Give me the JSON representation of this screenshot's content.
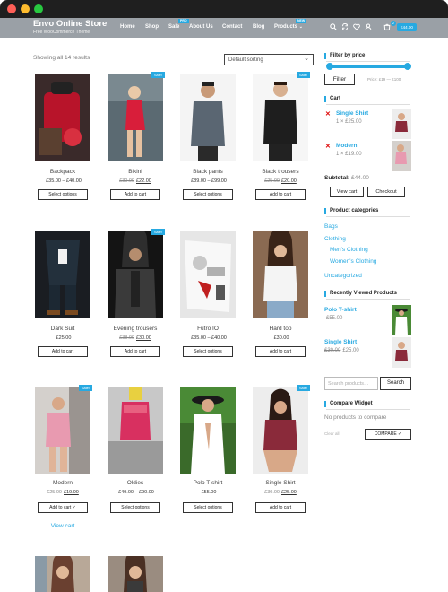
{
  "header": {
    "brand": "Envo Online Store",
    "tagline": "Free WooCommerce Theme",
    "nav": [
      {
        "label": "Home"
      },
      {
        "label": "Shop"
      },
      {
        "label": "Sale",
        "badge": "PRO"
      },
      {
        "label": "About Us"
      },
      {
        "label": "Contact"
      },
      {
        "label": "Blog"
      },
      {
        "label": "Products",
        "badge": "NEW",
        "icon": "chevron-down-icon"
      }
    ],
    "icons": [
      "search-icon",
      "compare-icon",
      "heart-icon",
      "user-icon",
      "cart-icon"
    ],
    "cart_count": "2",
    "cart_total": "£44.00",
    "accent": "#27a9e1"
  },
  "shop": {
    "result_count": "Showing all 14 results",
    "sorting": "Default sorting",
    "sale_badge": "Sale!",
    "view_cart": "View cart",
    "products": [
      {
        "name": "Backpack",
        "old": "",
        "price": "£35.00 – £40.00",
        "button": "Select options",
        "sale": false
      },
      {
        "name": "Bikini",
        "old": "£30.00",
        "price": "£22.00",
        "button": "Add to cart",
        "sale": true
      },
      {
        "name": "Black pants",
        "old": "",
        "price": "£89.00 – £99.00",
        "button": "Select options",
        "sale": false
      },
      {
        "name": "Black trousers",
        "old": "£25.00",
        "price": "£20.00",
        "button": "Add to cart",
        "sale": true
      },
      {
        "name": "Dark Suit",
        "old": "",
        "price": "£25.00",
        "button": "Add to cart",
        "sale": false
      },
      {
        "name": "Evening trousers",
        "old": "£38.00",
        "price": "£30.00",
        "button": "Add to cart",
        "sale": true
      },
      {
        "name": "Futro IO",
        "old": "",
        "price": "£35.00 – £40.00",
        "button": "Select options",
        "sale": false
      },
      {
        "name": "Hard top",
        "old": "",
        "price": "£30.00",
        "button": "Add to cart",
        "sale": false
      },
      {
        "name": "Modern",
        "old": "£25.00",
        "price": "£19.00",
        "button": "Add to cart ✓",
        "sale": true
      },
      {
        "name": "Oldies",
        "old": "",
        "price": "£49.00 – £90.00",
        "button": "Select options",
        "sale": false
      },
      {
        "name": "Polo T-shirt",
        "old": "",
        "price": "£55.00",
        "button": "Select options",
        "sale": false
      },
      {
        "name": "Single Shirt",
        "old": "£30.00",
        "price": "£25.00",
        "button": "Add to cart",
        "sale": true
      }
    ]
  },
  "sidebar": {
    "filter_title": "Filter by price",
    "filter_button": "Filter",
    "price_range": "Price: £19 — £100",
    "cart_title": "Cart",
    "cart_items": [
      {
        "name": "Single Shirt",
        "qty": "1 × £25.00"
      },
      {
        "name": "Modern",
        "qty": "1 × £19.00"
      }
    ],
    "subtotal_label": "Subtotal:",
    "subtotal_value": "£44.00",
    "view_cart_button": "View cart",
    "checkout_button": "Checkout",
    "categories_title": "Product categories",
    "categories": [
      "Bags",
      "Clothing",
      "Men's Clothing",
      "Women's Clothing",
      "Uncategorized"
    ],
    "recent_title": "Recently Viewed Products",
    "recent": [
      {
        "name": "Polo T-shirt",
        "old": "",
        "price": "£55.00"
      },
      {
        "name": "Single Shirt",
        "old": "£30.00",
        "price": "£25.00"
      }
    ],
    "search_placeholder": "Search products…",
    "search_button": "Search",
    "compare_title": "Compare Widget",
    "compare_empty": "No products to compare",
    "clear_all": "Clear all",
    "compare_button": "COMPARE ✓"
  }
}
